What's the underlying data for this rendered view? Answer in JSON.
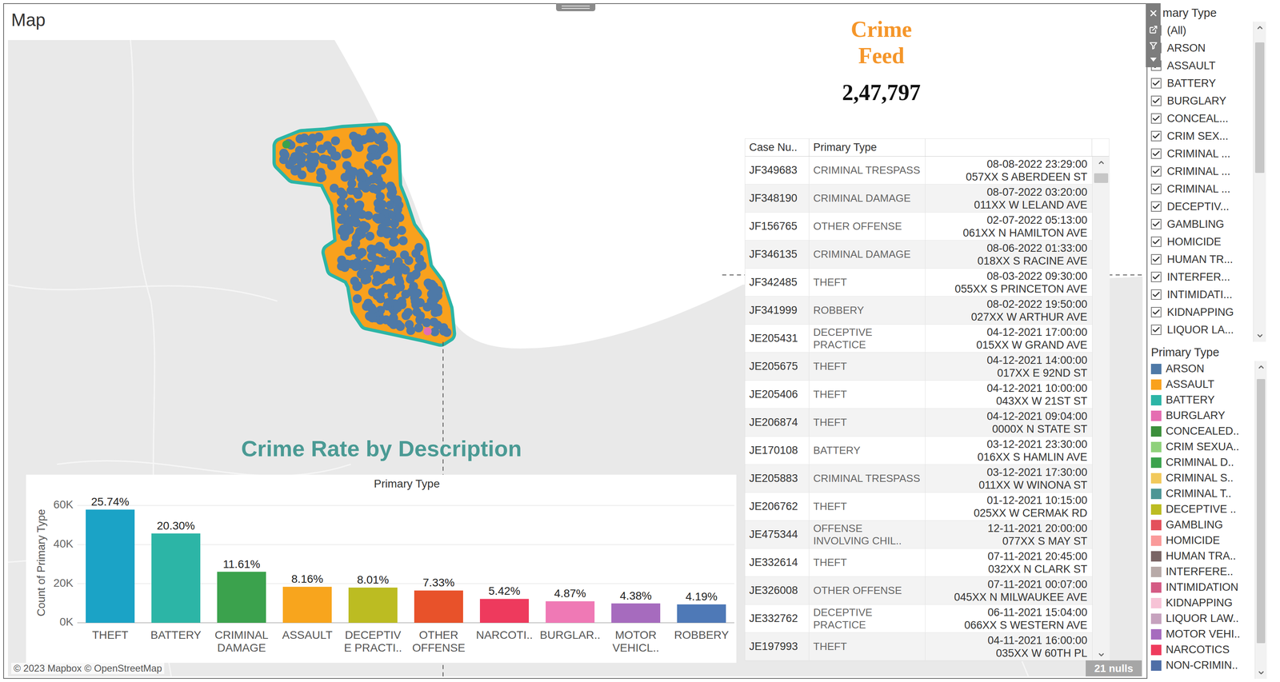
{
  "window": {
    "title": "Map"
  },
  "feed": {
    "title": "Crime Feed",
    "count": "2,47,797"
  },
  "table": {
    "columns": [
      "Case Nu..",
      "Primary Type"
    ],
    "rows": [
      {
        "case": "JF349683",
        "type": "CRIMINAL TRESPASS",
        "datetime": "08-08-2022 23:29:00",
        "address": "057XX S ABERDEEN ST"
      },
      {
        "case": "JF348190",
        "type": "CRIMINAL DAMAGE",
        "datetime": "08-07-2022 03:20:00",
        "address": "011XX W LELAND AVE"
      },
      {
        "case": "JF156765",
        "type": "OTHER OFFENSE",
        "datetime": "02-07-2022 05:13:00",
        "address": "061XX N HAMILTON AVE"
      },
      {
        "case": "JF346135",
        "type": "CRIMINAL DAMAGE",
        "datetime": "08-06-2022 01:33:00",
        "address": "018XX S RACINE AVE"
      },
      {
        "case": "JF342485",
        "type": "THEFT",
        "datetime": "08-03-2022 09:30:00",
        "address": "055XX S PRINCETON AVE"
      },
      {
        "case": "JF341999",
        "type": "ROBBERY",
        "datetime": "08-02-2022 19:50:00",
        "address": "027XX W ARTHUR AVE"
      },
      {
        "case": "JE205431",
        "type": "DECEPTIVE PRACTICE",
        "datetime": "04-12-2021 17:00:00",
        "address": "015XX W GRAND AVE"
      },
      {
        "case": "JE205675",
        "type": "THEFT",
        "datetime": "04-12-2021 14:00:00",
        "address": "017XX E 92ND ST"
      },
      {
        "case": "JE205406",
        "type": "THEFT",
        "datetime": "04-12-2021 10:00:00",
        "address": "043XX W 21ST ST"
      },
      {
        "case": "JE206874",
        "type": "THEFT",
        "datetime": "04-12-2021 09:04:00",
        "address": "0000X N STATE ST"
      },
      {
        "case": "JE170108",
        "type": "BATTERY",
        "datetime": "03-12-2021 23:30:00",
        "address": "016XX S HAMLIN AVE"
      },
      {
        "case": "JE205883",
        "type": "CRIMINAL TRESPASS",
        "datetime": "03-12-2021 17:30:00",
        "address": "011XX W WINONA ST"
      },
      {
        "case": "JE206762",
        "type": "THEFT",
        "datetime": "01-12-2021 10:15:00",
        "address": "025XX W CERMAK RD"
      },
      {
        "case": "JE475344",
        "type": "OFFENSE INVOLVING CHIL..",
        "datetime": "12-11-2021 20:00:00",
        "address": "077XX S MAY ST"
      },
      {
        "case": "JE332614",
        "type": "THEFT",
        "datetime": "07-11-2021 20:45:00",
        "address": "032XX N CLARK ST"
      },
      {
        "case": "JE326008",
        "type": "OTHER OFFENSE",
        "datetime": "07-11-2021 00:07:00",
        "address": "045XX N MILWAUKEE AVE"
      },
      {
        "case": "JE332762",
        "type": "DECEPTIVE PRACTICE",
        "datetime": "06-11-2021 15:04:00",
        "address": "066XX S WESTERN AVE"
      },
      {
        "case": "JE197993",
        "type": "THEFT",
        "datetime": "04-11-2021 16:00:00",
        "address": "035XX W 60TH PL"
      }
    ],
    "nulls": "21 nulls"
  },
  "chart": {
    "title": "Crime Rate by Description",
    "header": "Primary Type",
    "y_axis": "Count of Primary Type",
    "ticks": [
      {
        "label": "0K",
        "value": 0
      },
      {
        "label": "20K",
        "value": 20000
      },
      {
        "label": "40K",
        "value": 40000
      },
      {
        "label": "60K",
        "value": 60000
      }
    ],
    "max": 60000,
    "bars": [
      {
        "label": "THEFT",
        "pct": "25.74%",
        "value": 57900,
        "color": "#1ba3c6"
      },
      {
        "label": "BATTERY",
        "pct": "20.30%",
        "value": 45700,
        "color": "#2cb5a6"
      },
      {
        "label": "CRIMINAL DAMAGE",
        "pct": "11.61%",
        "value": 26100,
        "color": "#3ba24d"
      },
      {
        "label": "ASSAULT",
        "pct": "8.16%",
        "value": 18400,
        "color": "#f8a51d"
      },
      {
        "label": "DECEPTIVE PRACTI..",
        "pct": "8.01%",
        "value": 18000,
        "color": "#bcbc22"
      },
      {
        "label": "OTHER OFFENSE",
        "pct": "7.33%",
        "value": 16500,
        "color": "#e8522a"
      },
      {
        "label": "NARCOTI..",
        "pct": "5.42%",
        "value": 12200,
        "color": "#ee3a5d"
      },
      {
        "label": "BURGLAR..",
        "pct": "4.87%",
        "value": 11000,
        "color": "#ef79b5"
      },
      {
        "label": "MOTOR VEHICL..",
        "pct": "4.38%",
        "value": 9900,
        "color": "#a66bbe"
      },
      {
        "label": "ROBBERY",
        "pct": "4.19%",
        "value": 9400,
        "color": "#4e79b7"
      }
    ]
  },
  "filter": {
    "title": "mary Type",
    "items": [
      {
        "label": "(All)",
        "checked": true
      },
      {
        "label": "ARSON",
        "checked": true
      },
      {
        "label": "ASSAULT",
        "checked": true
      },
      {
        "label": "BATTERY",
        "checked": true
      },
      {
        "label": "BURGLARY",
        "checked": true
      },
      {
        "label": "CONCEAL...",
        "checked": true
      },
      {
        "label": "CRIM SEX...",
        "checked": true
      },
      {
        "label": "CRIMINAL ...",
        "checked": true
      },
      {
        "label": "CRIMINAL ...",
        "checked": true
      },
      {
        "label": "CRIMINAL ...",
        "checked": true
      },
      {
        "label": "DECEPTIV...",
        "checked": true
      },
      {
        "label": "GAMBLING",
        "checked": true
      },
      {
        "label": "HOMICIDE",
        "checked": true
      },
      {
        "label": "HUMAN TR...",
        "checked": true
      },
      {
        "label": "INTERFER...",
        "checked": true
      },
      {
        "label": "INTIMIDATI...",
        "checked": true
      },
      {
        "label": "KIDNAPPING",
        "checked": true
      },
      {
        "label": "LIQUOR LA...",
        "checked": true
      }
    ]
  },
  "legend": {
    "title": "Primary Type",
    "items": [
      {
        "label": "ARSON",
        "color": "#4e79a7"
      },
      {
        "label": "ASSAULT",
        "color": "#f9a11d"
      },
      {
        "label": "BATTERY",
        "color": "#2cb5a6"
      },
      {
        "label": "BURGLARY",
        "color": "#e56db1"
      },
      {
        "label": "CONCEALED..",
        "color": "#3c8f3c"
      },
      {
        "label": "CRIM SEXUA..",
        "color": "#8fd17b"
      },
      {
        "label": "CRIMINAL D..",
        "color": "#3ba24d"
      },
      {
        "label": "CRIMINAL S..",
        "color": "#f2c95c"
      },
      {
        "label": "CRIMINAL T..",
        "color": "#4d9695"
      },
      {
        "label": "DECEPTIVE ..",
        "color": "#bcbc22"
      },
      {
        "label": "GAMBLING",
        "color": "#e4505b"
      },
      {
        "label": "HOMICIDE",
        "color": "#fa9a9a"
      },
      {
        "label": "HUMAN TRA..",
        "color": "#7a6565"
      },
      {
        "label": "INTERFERE..",
        "color": "#b8aaa8"
      },
      {
        "label": "INTIMIDATION",
        "color": "#d45b84"
      },
      {
        "label": "KIDNAPPING",
        "color": "#f7c3d6"
      },
      {
        "label": "LIQUOR LAW..",
        "color": "#c6a2be"
      },
      {
        "label": "MOTOR VEHI..",
        "color": "#a66bbe"
      },
      {
        "label": "NARCOTICS",
        "color": "#ef3b5d"
      },
      {
        "label": "NON-CRIMIN..",
        "color": "#4e6ea7"
      }
    ]
  },
  "attribution": "© 2023 Mapbox © OpenStreetMap"
}
